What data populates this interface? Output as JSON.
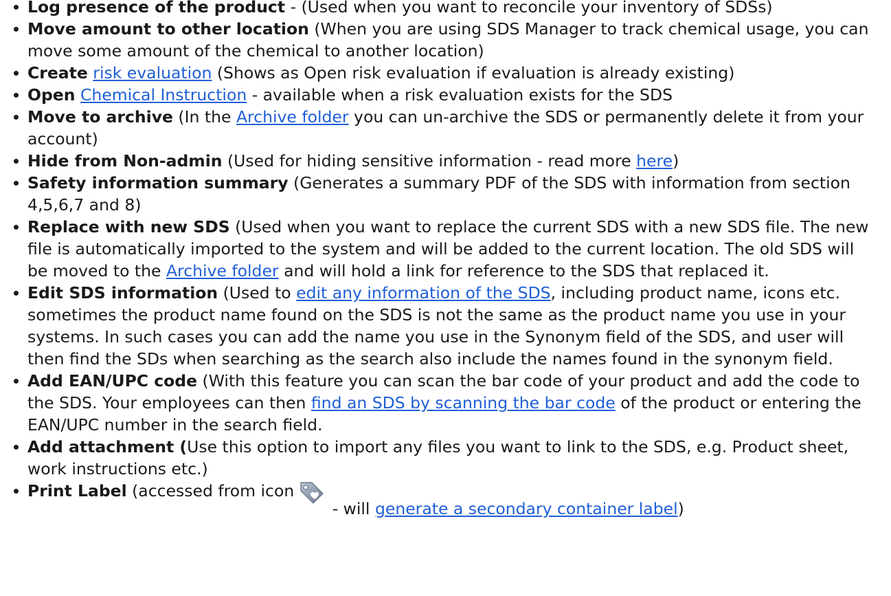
{
  "items": [
    {
      "title": "Log presence of the product",
      "text": " - (Used when you want to reconcile your inventory of SDSs)"
    },
    {
      "title": "Move amount to other location",
      "text": " (When you are using SDS Manager to track chemical usage, you can move some amount of the chemical to another location)"
    },
    {
      "title": "Create",
      "link": "risk evaluation",
      "text_after": " (Shows as Open risk evaluation if evaluation is already existing)"
    },
    {
      "title": "Open",
      "link": "Chemical Instruction",
      "text_after": " - available when a risk evaluation exists for the SDS"
    },
    {
      "title": "Move to archive",
      "text_before": " (In the ",
      "link": "Archive folder",
      "text_after": " you can un-archive the SDS or permanently delete it from your account)"
    },
    {
      "title": "Hide from Non-admin",
      "text_before": " (Used for hiding sensitive information - read more ",
      "link": "here",
      "text_after": ")"
    },
    {
      "title": "Safety information summary",
      "text": " (Generates a summary PDF of the SDS with information from section 4,5,6,7 and 8)"
    },
    {
      "title": "Replace with new SDS",
      "text_before": " (Used when you want to replace the current SDS with a new SDS file. The new file is automatically imported to the system and will be added to the current location.  The old SDS will be moved to the ",
      "link": "Archive folder",
      "text_after": " and will hold a link for reference to the SDS that replaced it."
    },
    {
      "title": "Edit SDS information",
      "text_before": " (Used to ",
      "link": "edit any information of the SDS",
      "text_after": ", including product name, icons etc. sometimes the product name found on the SDS is not the same as the product name you use in your systems.  In such cases you can add the name you use in the Synonym field of the SDS, and user will then find the SDs when searching as the search also include the names found in the synonym field."
    },
    {
      "title": "Add EAN/UPC code",
      "text_before": " (With this feature you can scan the bar code of your product and add the code to the SDS. Your employees can then ",
      "link": "find an SDS by scanning the bar code",
      "text_after": " of the product or entering the EAN/UPC number in the search field."
    },
    {
      "title": "Add attachment (",
      "text": "Use this option to import any files you want to link to the SDS, e.g. Product sheet, work instructions etc.)"
    },
    {
      "title": "Print Label",
      "text_before": " (accessed from icon",
      "icon": "tag-label-icon",
      "text_middle": " - will ",
      "link": "generate a secondary container label",
      "text_after": ")"
    }
  ],
  "colors": {
    "text": "#1a1a1a",
    "link": "#1f5fd6",
    "icon": "#8a96a8"
  }
}
